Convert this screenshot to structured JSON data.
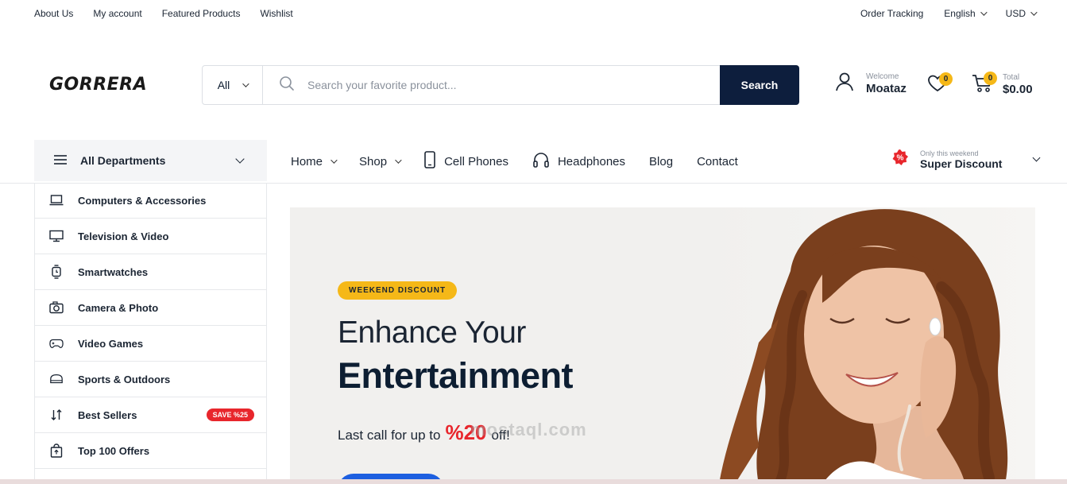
{
  "topbar": {
    "links": [
      "About Us",
      "My account",
      "Featured Products",
      "Wishlist"
    ],
    "order_tracking": "Order Tracking",
    "language": "English",
    "currency": "USD"
  },
  "header": {
    "logo": "GORRERA",
    "search": {
      "category": "All",
      "placeholder": "Search your favorite product...",
      "button": "Search"
    },
    "account": {
      "welcome": "Welcome",
      "name": "Moataz"
    },
    "wishlist_count": "0",
    "cart": {
      "count": "0",
      "total_label": "Total",
      "total": "$0.00"
    }
  },
  "nav": {
    "departments": "All Departments",
    "items": [
      "Home",
      "Shop",
      "Cell Phones",
      "Headphones",
      "Blog",
      "Contact"
    ],
    "promo": {
      "small": "Only this weekend",
      "big": "Super Discount"
    }
  },
  "categories": [
    "Computers & Accessories",
    "Television & Video",
    "Smartwatches",
    "Camera & Photo",
    "Video Games",
    "Sports & Outdoors",
    "Best Sellers",
    "Top 100 Offers"
  ],
  "save_badge": "SAVE %25",
  "hero": {
    "tag": "WEEKEND DISCOUNT",
    "title_line1": "Enhance Your",
    "title_line2": "Entertainment",
    "sub_prefix": "Last call for up to",
    "sub_percent": "%20",
    "sub_suffix": "off!"
  },
  "watermark": "mostaql.com",
  "colors": {
    "navy": "#0d1e3d",
    "accent_yellow": "#f5b818",
    "sale_red": "#e8262c",
    "cta_blue": "#1d5fe0"
  }
}
